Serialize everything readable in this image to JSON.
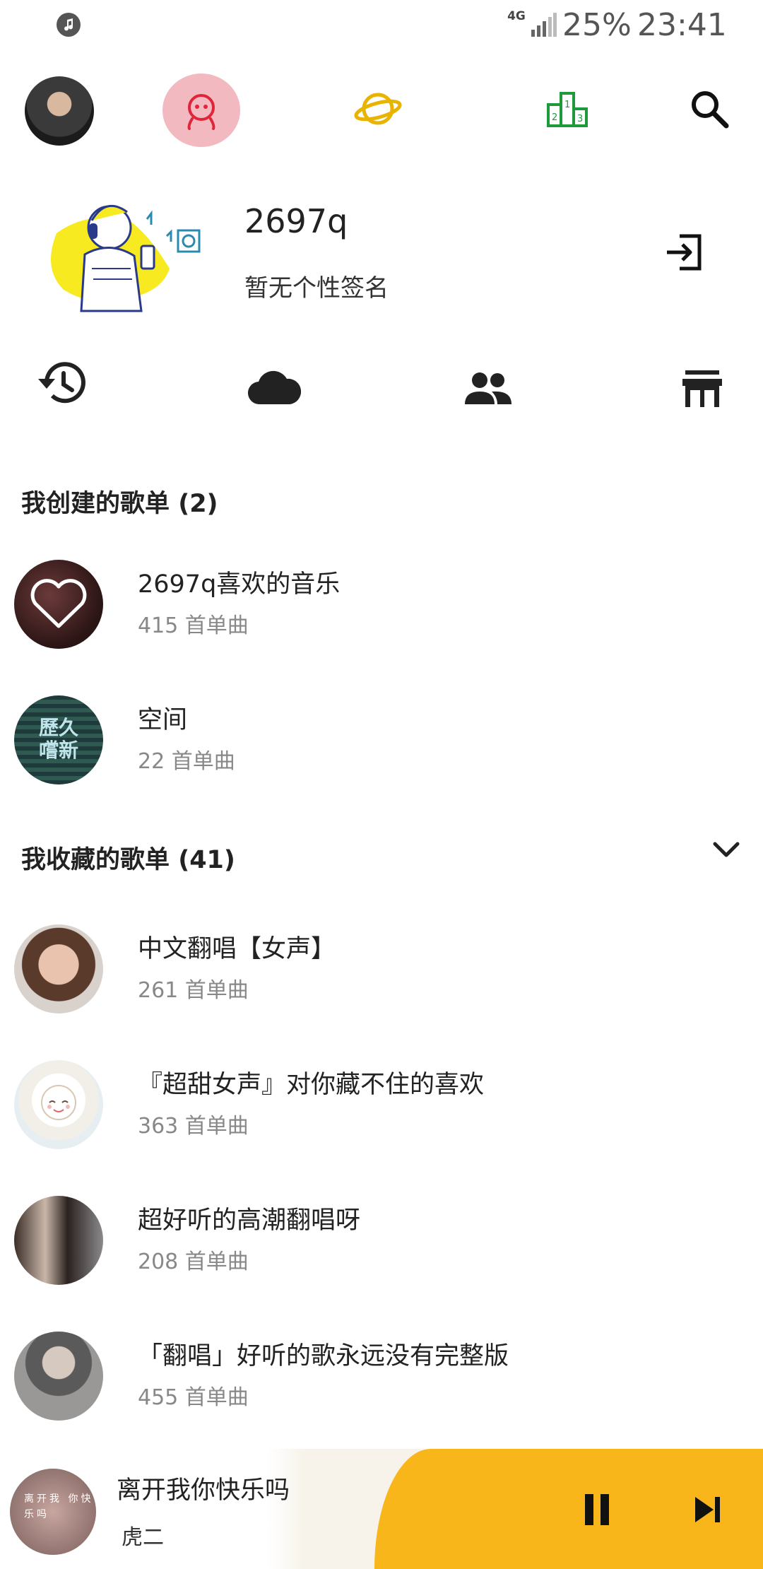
{
  "status_bar": {
    "network": "4G",
    "battery": "25%",
    "time": "23:41"
  },
  "profile": {
    "name": "2697q",
    "signature": "暂无个性签名"
  },
  "created_playlists": {
    "title": "我创建的歌单",
    "count": "(2)",
    "items": [
      {
        "title": "2697q喜欢的音乐",
        "count": "415 首单曲"
      },
      {
        "title": "空间",
        "count": "22 首单曲"
      }
    ]
  },
  "collected_playlists": {
    "title": "我收藏的歌单",
    "count": "(41)",
    "items": [
      {
        "title": "中文翻唱【女声】",
        "count": "261 首单曲"
      },
      {
        "title": "『超甜女声』对你藏不住的喜欢",
        "count": "363 首单曲"
      },
      {
        "title": "超好听的高潮翻唱呀",
        "count": "208 首单曲"
      },
      {
        "title": "「翻唱」好听的歌永远没有完整版",
        "count": "455 首单曲"
      }
    ]
  },
  "cover_art": {
    "space_text": "歷久 嚐新"
  },
  "player": {
    "title": "离开我你快乐吗",
    "artist": "虎二",
    "cover_text": "离开我 你快乐吗"
  },
  "colors": {
    "accent_yellow": "#f8b61b",
    "pink": "#f3b9c0",
    "discover_yellow": "#e8b400",
    "rank_green": "#1f9a3b",
    "mine_red": "#e0243a"
  },
  "icons": {
    "status_left": "music-note-icon",
    "nav_mine": "mine-face-icon",
    "nav_discover": "planet-icon",
    "nav_rank": "podium-icon",
    "nav_search": "search-icon",
    "logout": "logout-icon",
    "history": "history-icon",
    "cloud": "cloud-icon",
    "friends": "friends-icon",
    "store": "store-icon",
    "collapse": "chevron-down-icon",
    "pause": "pause-icon",
    "next": "skip-next-icon"
  }
}
